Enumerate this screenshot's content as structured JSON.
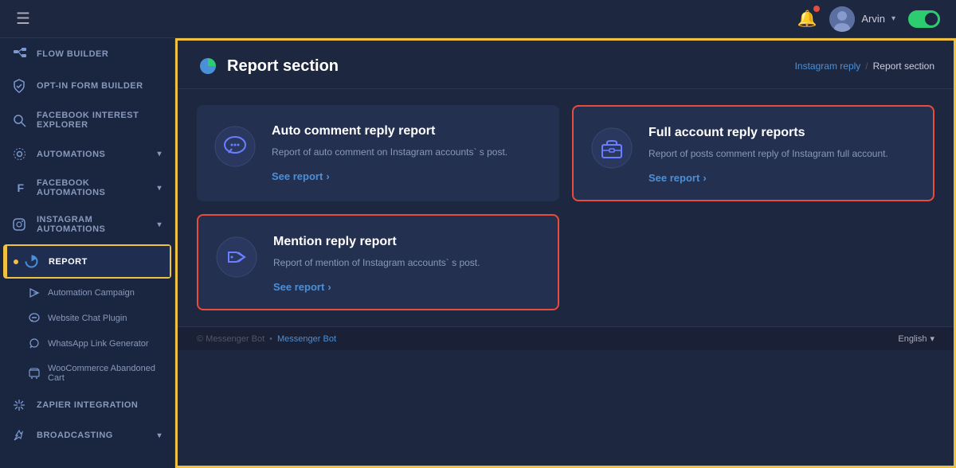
{
  "header": {
    "hamburger_label": "☰",
    "bell_label": "🔔",
    "user_name": "Arvin",
    "toggle_state": "on"
  },
  "sidebar": {
    "items": [
      {
        "id": "flow-builder",
        "label": "Flow Builder",
        "icon": "⤳",
        "has_arrow": false
      },
      {
        "id": "opt-in-form",
        "label": "Opt-In Form Builder",
        "icon": "🛡",
        "has_arrow": false
      },
      {
        "id": "facebook-interest",
        "label": "Facebook Interest Explorer",
        "icon": "🔍",
        "has_arrow": false
      },
      {
        "id": "automations",
        "label": "Automations",
        "icon": "⚙",
        "has_arrow": true
      },
      {
        "id": "facebook-automations",
        "label": "Facebook Automations",
        "icon": "f",
        "has_arrow": true
      },
      {
        "id": "instagram-automations",
        "label": "Instagram Automations",
        "icon": "◎",
        "has_arrow": true
      },
      {
        "id": "report",
        "label": "Report",
        "icon": "◕",
        "has_arrow": false,
        "active": true,
        "has_dot": true
      },
      {
        "id": "automation-campaign",
        "label": "Automation Campaign",
        "icon": "✦",
        "has_arrow": false,
        "sub": true
      },
      {
        "id": "website-chat",
        "label": "Website Chat Plugin",
        "icon": "💬",
        "has_arrow": false,
        "sub": true
      },
      {
        "id": "whatsapp-link",
        "label": "WhatsApp Link Generator",
        "icon": "⚡",
        "has_arrow": false,
        "sub": true
      },
      {
        "id": "woocommerce",
        "label": "WooCommerce Abandoned Cart",
        "icon": "🛒",
        "has_arrow": false,
        "sub": true
      },
      {
        "id": "zapier",
        "label": "Zapier Integration",
        "icon": "⚡",
        "has_arrow": false,
        "sub": false
      },
      {
        "id": "broadcasting",
        "label": "Broadcasting",
        "icon": "📡",
        "has_arrow": true
      }
    ]
  },
  "content": {
    "title": "Report section",
    "breadcrumb": {
      "parent": "Instagram reply",
      "current": "Report section"
    },
    "cards": [
      {
        "id": "auto-comment",
        "title": "Auto comment reply report",
        "description": "Report of auto comment on Instagram accounts` s post.",
        "link_label": "See report",
        "highlighted": false
      },
      {
        "id": "full-account",
        "title": "Full account reply reports",
        "description": "Report of posts comment reply of Instagram full account.",
        "link_label": "See report",
        "highlighted": true
      },
      {
        "id": "mention-reply",
        "title": "Mention reply report",
        "description": "Report of mention of Instagram accounts` s post.",
        "link_label": "See report",
        "highlighted": true
      }
    ]
  },
  "footer": {
    "copyright": "© Messenger Bot",
    "link_label": "Messenger Bot",
    "language": "English"
  }
}
